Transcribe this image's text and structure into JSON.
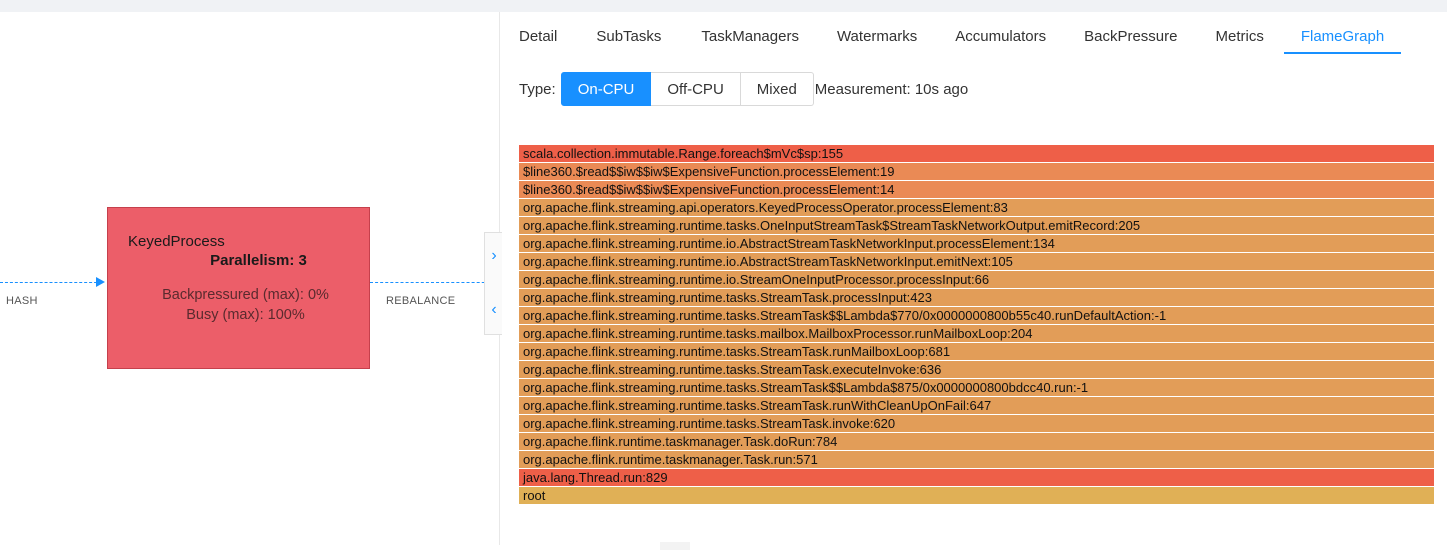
{
  "graph": {
    "edge_in_label": "HASH",
    "edge_out_label": "REBALANCE",
    "node": {
      "title": "KeyedProcess",
      "parallelism": "Parallelism: 3",
      "backpressured": "Backpressured (max): 0%",
      "busy": "Busy (max): 100%",
      "color": "#ec5e69"
    },
    "edge_color": "#1890ff"
  },
  "panel_toggle": {
    "expand_glyph": "›",
    "collapse_glyph": "‹"
  },
  "tabs": [
    {
      "label": "Detail",
      "active": false
    },
    {
      "label": "SubTasks",
      "active": false
    },
    {
      "label": "TaskManagers",
      "active": false
    },
    {
      "label": "Watermarks",
      "active": false
    },
    {
      "label": "Accumulators",
      "active": false
    },
    {
      "label": "BackPressure",
      "active": false
    },
    {
      "label": "Metrics",
      "active": false
    },
    {
      "label": "FlameGraph",
      "active": true
    }
  ],
  "flamegraph": {
    "type_label": "Type:",
    "types": [
      {
        "label": "On-CPU",
        "active": true
      },
      {
        "label": "Off-CPU",
        "active": false
      },
      {
        "label": "Mixed",
        "active": false
      }
    ],
    "measurement": "Measurement: 10s ago",
    "frames": [
      {
        "label": "scala.collection.immutable.Range.foreach$mVc$sp:155",
        "color": "#ee5f48"
      },
      {
        "label": "$line360.$read$$iw$$iw$ExpensiveFunction.processElement:19",
        "color": "#ea8a55"
      },
      {
        "label": "$line360.$read$$iw$$iw$ExpensiveFunction.processElement:14",
        "color": "#ea8a55"
      },
      {
        "label": "org.apache.flink.streaming.api.operators.KeyedProcessOperator.processElement:83",
        "color": "#e29d58"
      },
      {
        "label": "org.apache.flink.streaming.runtime.tasks.OneInputStreamTask$StreamTaskNetworkOutput.emitRecord:205",
        "color": "#e29d58"
      },
      {
        "label": "org.apache.flink.streaming.runtime.io.AbstractStreamTaskNetworkInput.processElement:134",
        "color": "#e29d58"
      },
      {
        "label": "org.apache.flink.streaming.runtime.io.AbstractStreamTaskNetworkInput.emitNext:105",
        "color": "#e29d58"
      },
      {
        "label": "org.apache.flink.streaming.runtime.io.StreamOneInputProcessor.processInput:66",
        "color": "#e29d58"
      },
      {
        "label": "org.apache.flink.streaming.runtime.tasks.StreamTask.processInput:423",
        "color": "#e29d58"
      },
      {
        "label": "org.apache.flink.streaming.runtime.tasks.StreamTask$$Lambda$770/0x0000000800b55c40.runDefaultAction:-1",
        "color": "#e29d58"
      },
      {
        "label": "org.apache.flink.streaming.runtime.tasks.mailbox.MailboxProcessor.runMailboxLoop:204",
        "color": "#e29d58"
      },
      {
        "label": "org.apache.flink.streaming.runtime.tasks.StreamTask.runMailboxLoop:681",
        "color": "#e29d58"
      },
      {
        "label": "org.apache.flink.streaming.runtime.tasks.StreamTask.executeInvoke:636",
        "color": "#e29d58"
      },
      {
        "label": "org.apache.flink.streaming.runtime.tasks.StreamTask$$Lambda$875/0x0000000800bdcc40.run:-1",
        "color": "#e29d58"
      },
      {
        "label": "org.apache.flink.streaming.runtime.tasks.StreamTask.runWithCleanUpOnFail:647",
        "color": "#e29d58"
      },
      {
        "label": "org.apache.flink.streaming.runtime.tasks.StreamTask.invoke:620",
        "color": "#e29d58"
      },
      {
        "label": "org.apache.flink.runtime.taskmanager.Task.doRun:784",
        "color": "#e29d58"
      },
      {
        "label": "org.apache.flink.runtime.taskmanager.Task.run:571",
        "color": "#e29d58"
      },
      {
        "label": "java.lang.Thread.run:829",
        "color": "#ee5f48"
      },
      {
        "label": "root",
        "color": "#e0b056"
      }
    ]
  }
}
